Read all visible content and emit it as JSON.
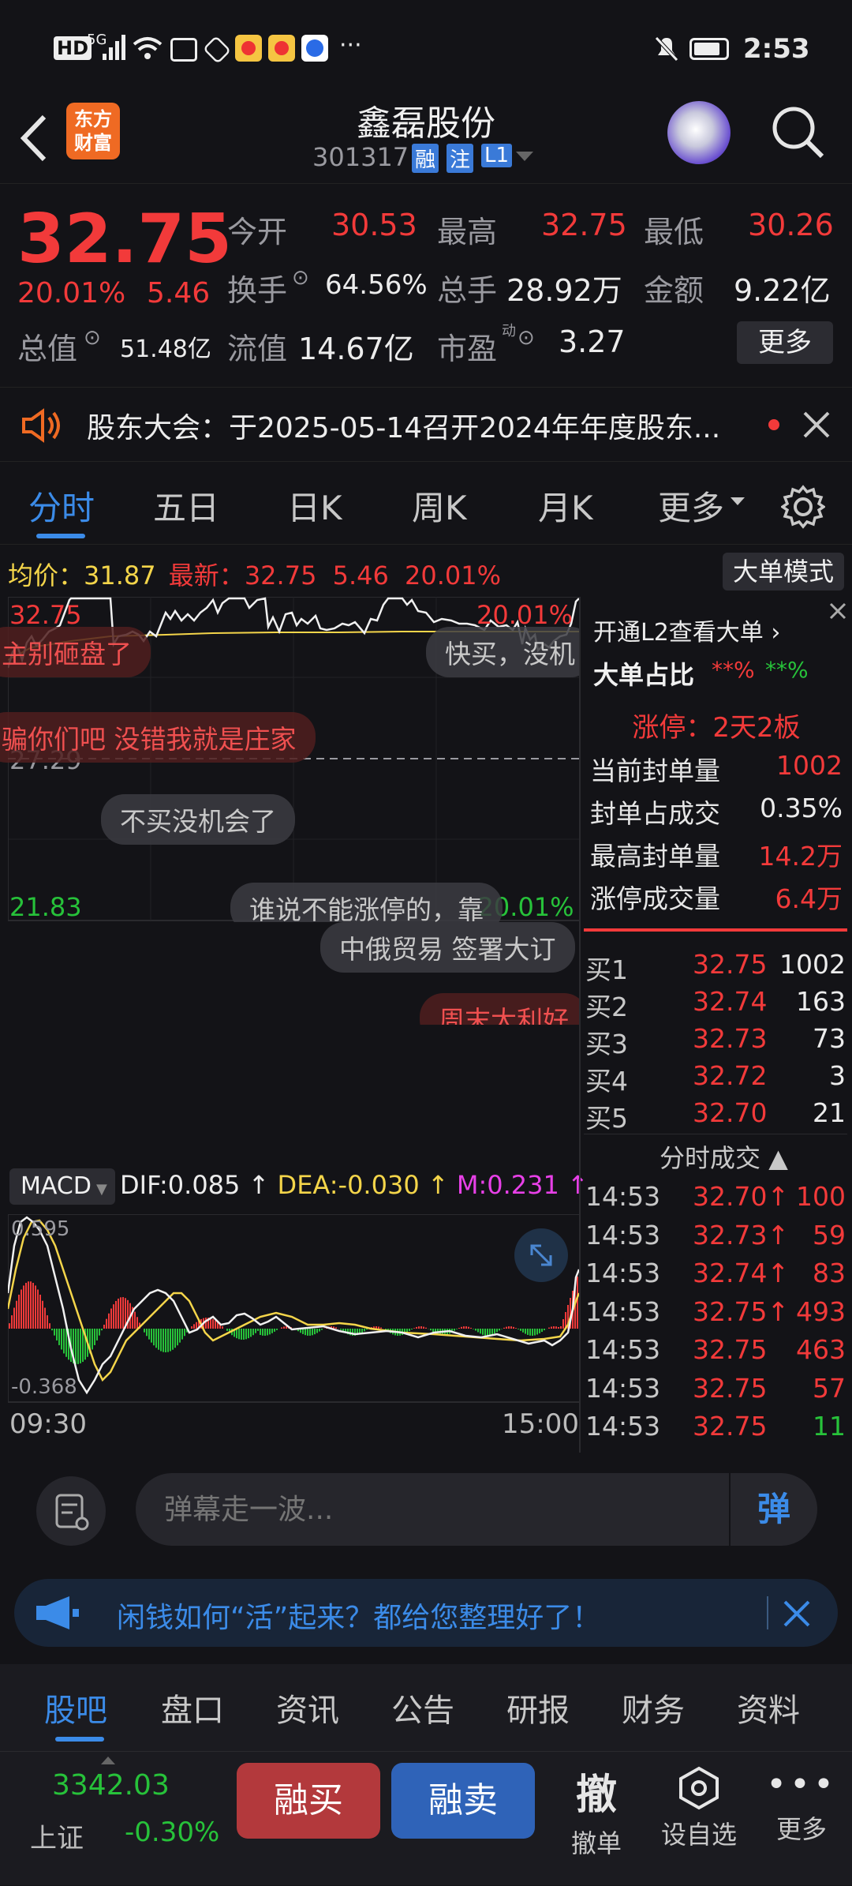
{
  "status": {
    "time": "2:53",
    "net": "5G",
    "hd": "HD",
    "more": "···"
  },
  "header": {
    "logo_line1": "东方",
    "logo_line2": "财富",
    "stock_name": "鑫磊股份",
    "stock_code": "301317",
    "badge_rong": "融",
    "badge_zhu": "注",
    "badge_l1": "L1"
  },
  "quote": {
    "price": "32.75",
    "change_pct": "20.01%",
    "change": "5.46",
    "open_label": "今开",
    "open": "30.53",
    "high_label": "最高",
    "high": "32.75",
    "low_label": "最低",
    "low": "30.26",
    "turnover_label": "换手",
    "turnover": "64.56%",
    "volume_label": "总手",
    "volume": "28.92万",
    "amount_label": "金额",
    "amount": "9.22亿",
    "mcap_label": "总值",
    "mcap": "51.48亿",
    "float_label": "流值",
    "float": "14.67亿",
    "pe_label": "市盈",
    "pe_sup": "动",
    "pe": "3.27",
    "more_btn": "更多"
  },
  "notice": {
    "text": "股东大会：于2025-05-14召开2024年年度股东..."
  },
  "tabs": [
    "分时",
    "五日",
    "日K",
    "周K",
    "月K",
    "更多"
  ],
  "chart": {
    "avg_label": "均价：",
    "avg": "31.87",
    "latest_label": "最新：",
    "latest": "32.75",
    "latest_chg": "5.46",
    "latest_pct": "20.01%",
    "big_order_btn": "大单模式",
    "ymax": "32.75",
    "ymax_pct": "20.01%",
    "ymid": "27.29",
    "ymin": "21.83",
    "ymin_pct": "-20.01%",
    "macd_btn": "MACD",
    "dif": "DIF:0.085",
    "dea": "DEA:-0.030",
    "m": "M:0.231",
    "macd_top": "0.595",
    "macd_bottom": "-0.368",
    "time_start": "09:30",
    "time_end": "15:00"
  },
  "danmu": [
    "主别砸盘了",
    "快买，没机",
    "骗你们吧  没错我就是庄家",
    "不买没机会了",
    "谁说不能涨停的，靠",
    "中俄贸易 签署大订",
    "周末大利好"
  ],
  "panel": {
    "l2_link": "开通L2查看大单",
    "big_ratio_label": "大单占比",
    "big_ratio_buy": "**%",
    "big_ratio_sell": "**%",
    "limit_title": "涨停：2天2板",
    "limit_rows": [
      {
        "label": "当前封单量",
        "value": "1002"
      },
      {
        "label": "封单占成交",
        "value": "0.35%"
      },
      {
        "label": "最高封单量",
        "value": "14.2万"
      },
      {
        "label": "涨停成交量",
        "value": "6.4万"
      }
    ],
    "bids": [
      {
        "label": "买1",
        "price": "32.75",
        "vol": "1002"
      },
      {
        "label": "买2",
        "price": "32.74",
        "vol": "163"
      },
      {
        "label": "买3",
        "price": "32.73",
        "vol": "73"
      },
      {
        "label": "买4",
        "price": "32.72",
        "vol": "3"
      },
      {
        "label": "买5",
        "price": "32.70",
        "vol": "21"
      }
    ],
    "ticks_title": "分时成交",
    "ticks": [
      {
        "time": "14:53",
        "price": "32.70↑",
        "vol": "100"
      },
      {
        "time": "14:53",
        "price": "32.73↑",
        "vol": "59"
      },
      {
        "time": "14:53",
        "price": "32.74↑",
        "vol": "83"
      },
      {
        "time": "14:53",
        "price": "32.75↑",
        "vol": "493"
      },
      {
        "time": "14:53",
        "price": "32.75",
        "vol": "463"
      },
      {
        "time": "14:53",
        "price": "32.75",
        "vol": "57"
      },
      {
        "time": "14:53",
        "price": "32.75",
        "vol": "11"
      }
    ]
  },
  "comment": {
    "placeholder": "弹幕走一波...",
    "send": "弹"
  },
  "ad": {
    "text": "闲钱如何“活”起来？都给您整理好了！"
  },
  "bottom_tabs": [
    "股吧",
    "盘口",
    "资讯",
    "公告",
    "研报",
    "财务",
    "资料"
  ],
  "footer": {
    "index_value": "3342.03",
    "index_name": "上证",
    "index_pct": "-0.30%",
    "buy": "融买",
    "sell": "融卖",
    "cancel_glyph": "撤",
    "cancel": "撤单",
    "watch": "设自选",
    "more": "更多"
  },
  "colors": {
    "up": "#f23a3a",
    "down": "#27c23a",
    "accent": "#3b8be8"
  }
}
